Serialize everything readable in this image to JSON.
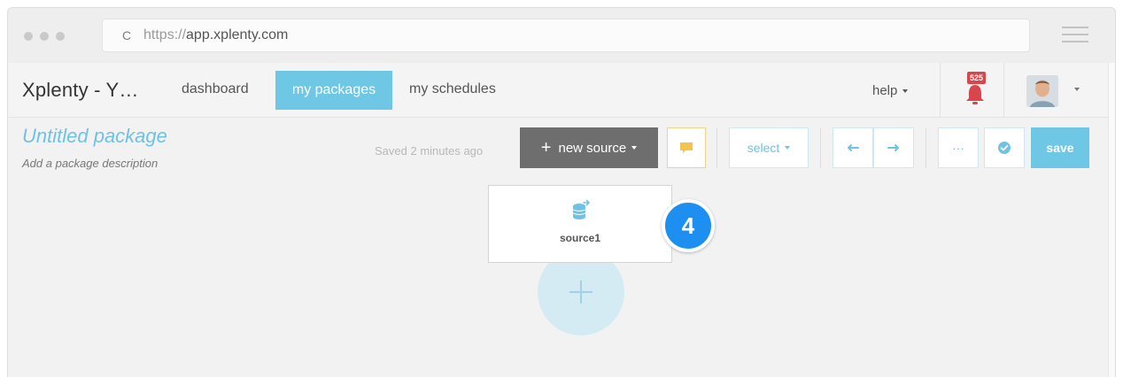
{
  "browser": {
    "url_protocol": "https://",
    "url_host": "app.xplenty.com",
    "reload_glyph": "C"
  },
  "navbar": {
    "brand": "Xplenty - Y…",
    "links": [
      {
        "label": "dashboard",
        "active": false
      },
      {
        "label": "my packages",
        "active": true
      },
      {
        "label": "my schedules",
        "active": false
      }
    ],
    "help_label": "help",
    "notifications_count": "525"
  },
  "package": {
    "title": "Untitled package",
    "description": "Add a package description",
    "saved_status": "Saved 2 minutes ago"
  },
  "toolbar": {
    "new_source_label": "new source",
    "select_label": "select",
    "more_label": "···",
    "save_label": "save"
  },
  "canvas": {
    "node_label": "source1",
    "step_number": "4"
  },
  "colors": {
    "accent": "#6fc7e6",
    "dark_button": "#6e6e6e",
    "badge_red": "#d9454b",
    "step_blue": "#1d8ff0",
    "note_yellow": "#f2c44e"
  },
  "icons": [
    "reload-icon",
    "hamburger-menu-icon",
    "bell-icon",
    "note-icon",
    "undo-icon",
    "redo-icon",
    "check-circle-icon",
    "database-source-icon",
    "plus-icon"
  ]
}
